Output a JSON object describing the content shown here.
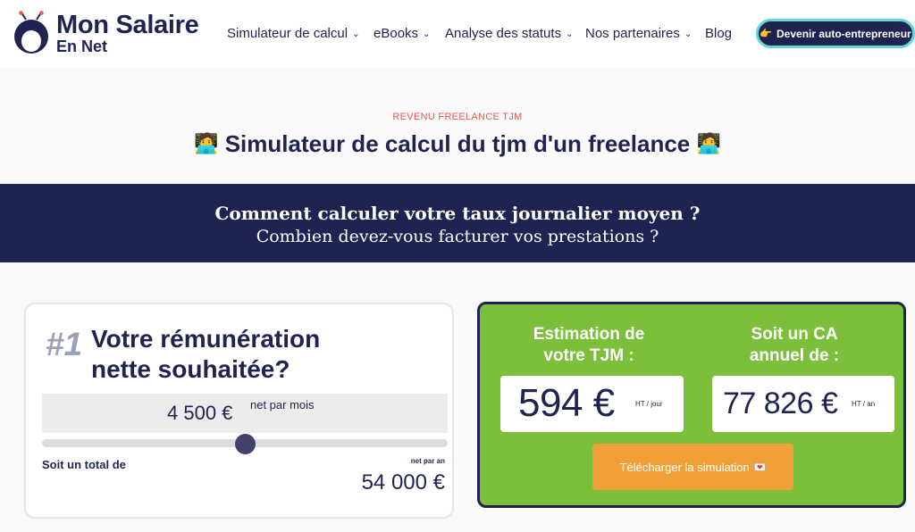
{
  "brand": {
    "line1": "Mon Salaire",
    "line2": "En Net"
  },
  "nav": {
    "items": [
      {
        "label": "Simulateur de calcul",
        "chevron": "⌄"
      },
      {
        "label": "eBooks",
        "chevron": "⌄"
      },
      {
        "label": "Analyse des statuts",
        "chevron": "⌄"
      },
      {
        "label": "Nos partenaires",
        "chevron": "⌄"
      },
      {
        "label": "Blog",
        "chevron": ""
      }
    ],
    "cta_label": "Devenir auto-entrepreneur"
  },
  "hero": {
    "eyebrow": "REVENU FREELANCE TJM",
    "title": "Simulateur de calcul du tjm d'un freelance"
  },
  "banner": {
    "line1": "Comment calculer votre taux journalier moyen ?",
    "line2": "Combien devez-vous facturer vos prestations ?"
  },
  "remuneration": {
    "step": "#1",
    "title_line1": "Votre rémunération",
    "title_line2": "nette souhaitée?",
    "amount": "4 500 €",
    "amount_unit": "net par mois",
    "slider_fraction": 0.5,
    "total_label": "Soit un total de",
    "total_unit": "net par an",
    "total_value": "54 000 €"
  },
  "result": {
    "tjm_label_line1": "Estimation de",
    "tjm_label_line2": "votre TJM :",
    "tjm_value": "594 €",
    "tjm_unit": "HT / jour",
    "ca_label_line1": "Soit un CA",
    "ca_label_line2": "annuel de :",
    "ca_value": "77 826 €",
    "ca_unit": "HT / an",
    "download_label": "Télécharger la simulation"
  },
  "colors": {
    "navy": "#1f2352",
    "accent_teal": "#5fd6cf",
    "eyebrow_red": "#e45b4b",
    "result_green": "#7bbf3a",
    "button_orange": "#f1a038"
  },
  "icons": {
    "logo": "owl-mascot-icon",
    "title_emoji": "technologist-emoji-icon",
    "cta_emoji": "pointing-hand-icon",
    "download_emoji": "love-letter-icon"
  }
}
